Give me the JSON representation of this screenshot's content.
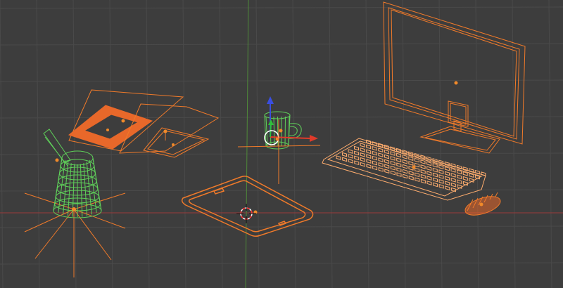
{
  "viewport": {
    "mode": "wireframe",
    "colors": {
      "background": "#3d3d3d",
      "grid": "#4a4a4a",
      "x_axis": "#9b3a3a",
      "y_axis": "#4f8a3a",
      "selected": "#f07a2a",
      "active": "#ffad6e",
      "green_object": "#5fd15a",
      "origin_dot": "#f08a2a",
      "gizmo_x": "#e03a2a",
      "gizmo_y": "#2ec03a",
      "gizmo_z": "#3a4ee0"
    },
    "objects": [
      {
        "name": "lamp",
        "state": "unselected"
      },
      {
        "name": "picture-frame",
        "state": "selected"
      },
      {
        "name": "photo-frame-stand",
        "state": "selected"
      },
      {
        "name": "mug",
        "state": "unselected"
      },
      {
        "name": "tablet",
        "state": "selected"
      },
      {
        "name": "monitor",
        "state": "selected"
      },
      {
        "name": "keyboard",
        "state": "active"
      },
      {
        "name": "mouse",
        "state": "selected"
      }
    ],
    "icons": [
      "3d-cursor-icon",
      "transform-gizmo-icon"
    ]
  }
}
